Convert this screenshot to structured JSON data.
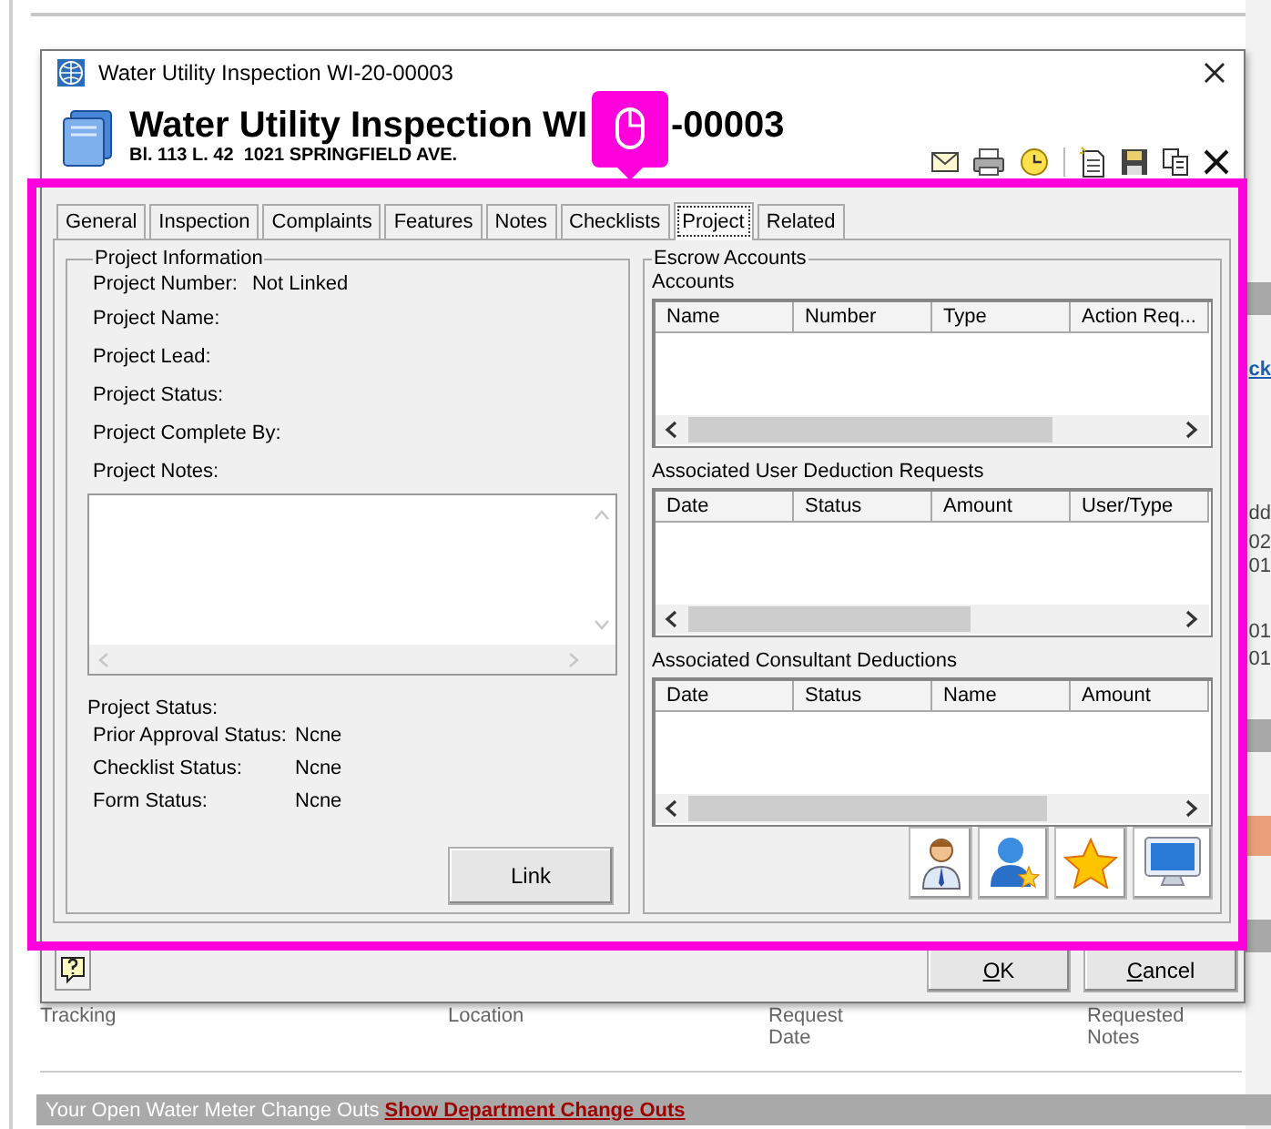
{
  "background": {
    "columns": [
      "Tracking",
      "Location",
      "Request Date",
      "Requested Notes"
    ],
    "edge_texts": [
      {
        "text": "ck",
        "kind": "link"
      },
      {
        "text": "dd",
        "kind": "text"
      },
      {
        "text": "02",
        "kind": "text"
      },
      {
        "text": "01",
        "kind": "text"
      },
      {
        "text": "01",
        "kind": "text"
      },
      {
        "text": "01",
        "kind": "text"
      }
    ],
    "banner": {
      "text": "Your Open Water Meter Change Outs",
      "link": "Show Department Change Outs"
    }
  },
  "dialog": {
    "title": "Water Utility Inspection WI-20-00003",
    "heading_parts": [
      "Water Utility Inspection WI",
      "-00003"
    ],
    "address": "Bl. 113 L. 42  1021 SPRINGFIELD AVE.",
    "tabs": [
      {
        "label": "General",
        "selected": false
      },
      {
        "label": "Inspection",
        "selected": false
      },
      {
        "label": "Complaints",
        "selected": false
      },
      {
        "label": "Features",
        "selected": false
      },
      {
        "label": "Notes",
        "selected": false
      },
      {
        "label": "Checklists",
        "selected": false
      },
      {
        "label": "Project",
        "selected": true
      },
      {
        "label": "Related",
        "selected": false
      }
    ],
    "project_info": {
      "title": "Project Information",
      "fields": [
        {
          "label": "Project Number:",
          "value": "Not Linked"
        },
        {
          "label": "Project Name:"
        },
        {
          "label": "Project Lead:"
        },
        {
          "label": "Project Status:"
        },
        {
          "label": "Project Complete By:"
        }
      ],
      "notes_label": "Project Notes:",
      "status_heading": "Project  Status:",
      "statuses": [
        {
          "label": "Prior Approval  Status:",
          "value": "Ncne"
        },
        {
          "label": "Checklist  Status:",
          "value": "Ncne"
        },
        {
          "label": "Form  Status:",
          "value": "Ncne"
        }
      ],
      "link_button": "Link"
    },
    "escrow": {
      "title": "Escrow Accounts",
      "tables": [
        {
          "title": "Accounts",
          "columns": [
            "Name",
            "Number",
            "Type",
            "Action Req..."
          ]
        },
        {
          "title": "Associated User Deduction Requests",
          "columns": [
            "Date",
            "Status",
            "Amount",
            "User/Type"
          ]
        },
        {
          "title": "Associated Consultant Deductions",
          "columns": [
            "Date",
            "Status",
            "Name",
            "Amount"
          ]
        }
      ]
    },
    "buttons": [
      {
        "label": "OK",
        "kind": "ok"
      },
      {
        "label": "Cancel",
        "kind": "cancel"
      }
    ]
  }
}
